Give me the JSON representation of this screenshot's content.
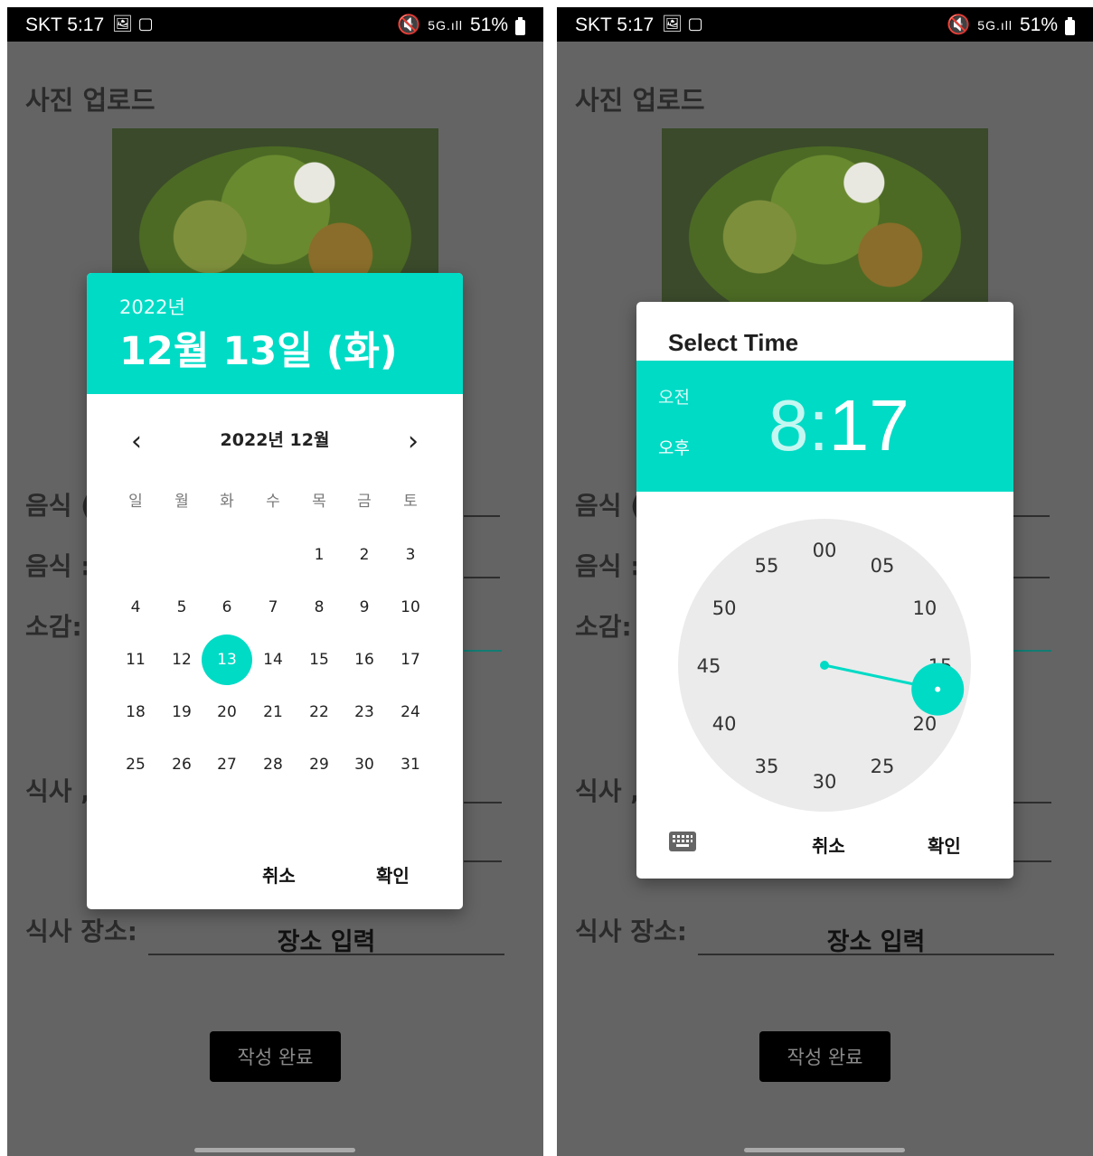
{
  "status_bar": {
    "carrier_time": "SKT 5:17",
    "battery": "51%"
  },
  "form": {
    "photo_upload_title": "사진 업로드",
    "labels": [
      "음식 (",
      "음식 :",
      "소감:",
      "식사 ,",
      "식사 장소:"
    ],
    "place_input": "장소 입력",
    "submit_label": "작성 완료"
  },
  "date_picker": {
    "header_year": "2022년",
    "header_date": "12월 13일 (화)",
    "month_label": "2022년 12월",
    "prev_symbol": "‹",
    "next_symbol": "›",
    "weekdays": [
      "일",
      "월",
      "화",
      "수",
      "목",
      "금",
      "토"
    ],
    "weeks": [
      [
        "",
        "",
        "",
        "",
        "1",
        "2",
        "3"
      ],
      [
        "4",
        "5",
        "6",
        "7",
        "8",
        "9",
        "10"
      ],
      [
        "11",
        "12",
        "13",
        "14",
        "15",
        "16",
        "17"
      ],
      [
        "18",
        "19",
        "20",
        "21",
        "22",
        "23",
        "24"
      ],
      [
        "25",
        "26",
        "27",
        "28",
        "29",
        "30",
        "31"
      ]
    ],
    "selected_day": "13",
    "cancel_label": "취소",
    "ok_label": "확인"
  },
  "time_picker": {
    "title": "Select Time",
    "am_label": "오전",
    "pm_label": "오후",
    "hour": "8",
    "separator": ":",
    "minute": "17",
    "dial_numbers": [
      "00",
      "05",
      "10",
      "15",
      "20",
      "25",
      "30",
      "35",
      "40",
      "45",
      "50",
      "55"
    ],
    "selected_minute": 17,
    "cancel_label": "취소",
    "ok_label": "확인"
  },
  "colors": {
    "accent": "#00dbc6",
    "scrim": "#646464",
    "dial_bg": "#ebebeb"
  }
}
